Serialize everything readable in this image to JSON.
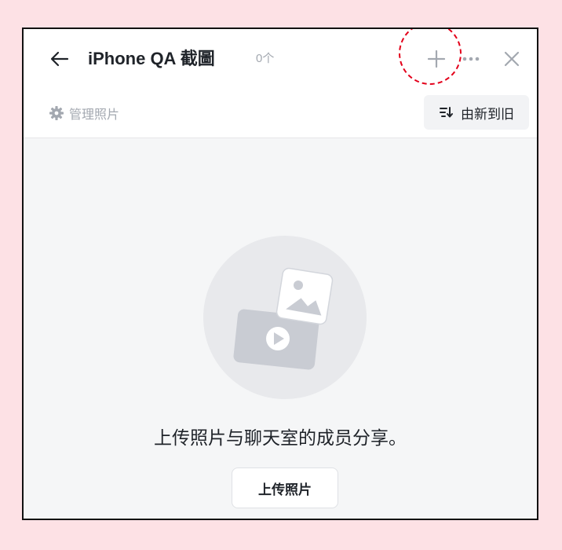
{
  "header": {
    "back_icon": "arrow-left-icon",
    "title": "iPhone QA 截圖",
    "count": "0个",
    "add_icon": "plus-icon",
    "more_icon": "more-dots-icon",
    "close_icon": "close-icon"
  },
  "toolbar": {
    "manage_icon": "gear-icon",
    "manage_label": "管理照片",
    "sort_icon": "sort-icon",
    "sort_label": "由新到旧"
  },
  "empty_state": {
    "illustration": "photo-video-illustration",
    "message": "上传照片与聊天室的成员分享。",
    "upload_label": "上传照片"
  },
  "colors": {
    "page_background": "#fde1e5",
    "highlight": "#e3001b",
    "muted_text": "#a3a8b0",
    "body_background": "#f5f6f7"
  }
}
